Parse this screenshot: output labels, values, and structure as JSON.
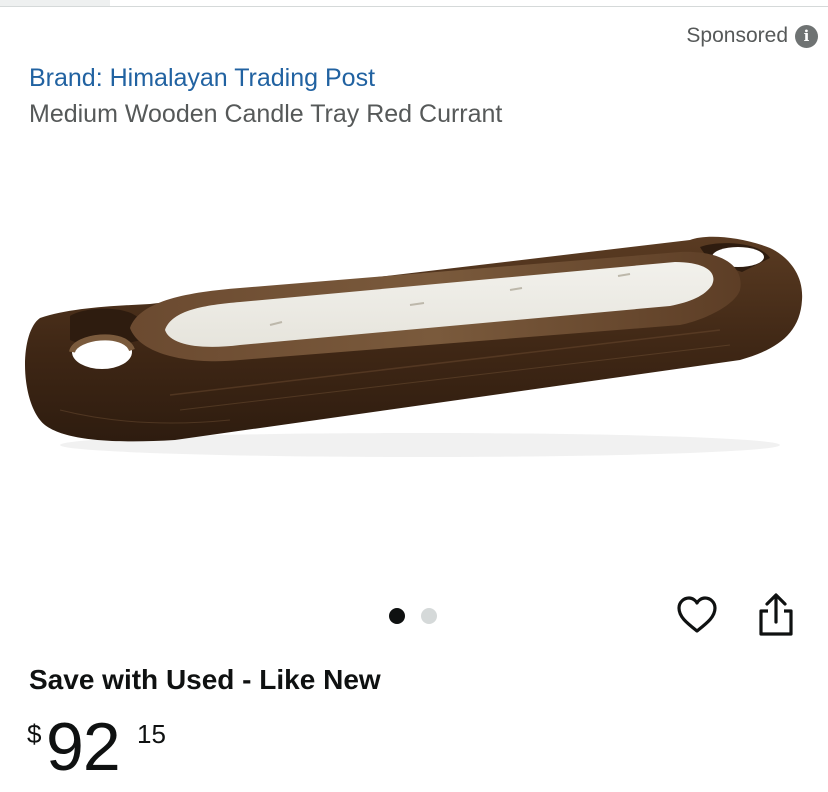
{
  "sponsored": {
    "label": "Sponsored",
    "icon": "info-icon",
    "icon_glyph": "i"
  },
  "product": {
    "brand_label": "Brand: Himalayan Trading Post",
    "title": "Medium Wooden Candle Tray Red Currant",
    "image_alt": "Medium Wooden Candle Tray Red Currant",
    "image_description": "dark wooden dough-bowl candle tray with handles, filled with white wax"
  },
  "carousel": {
    "total": 2,
    "active_index": 0
  },
  "actions": {
    "wishlist_icon": "heart-icon",
    "share_icon": "share-icon"
  },
  "offer": {
    "heading": "Save with Used - Like New",
    "price": {
      "symbol": "$",
      "whole": "92",
      "fraction": "15"
    }
  },
  "colors": {
    "link": "#2162a1",
    "text_primary": "#0f1111",
    "text_secondary": "#565959",
    "dot_inactive": "#d5d9d9",
    "info_icon_bg": "#6f7373"
  }
}
